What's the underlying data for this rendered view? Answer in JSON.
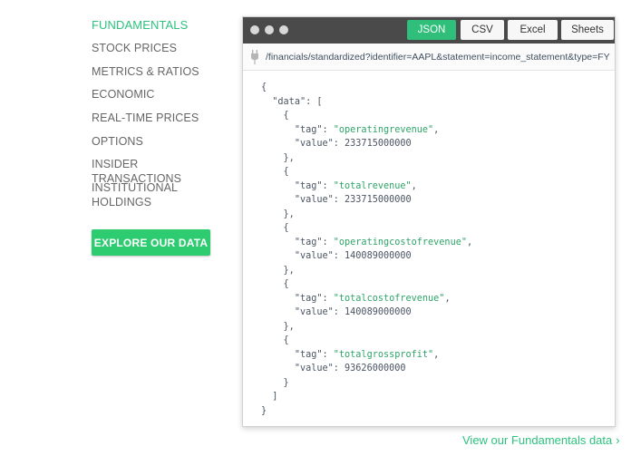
{
  "nav": {
    "items": [
      {
        "label": "FUNDAMENTALS",
        "active": true
      },
      {
        "label": "STOCK PRICES"
      },
      {
        "label": "METRICS & RATIOS"
      },
      {
        "label": "ECONOMIC"
      },
      {
        "label": "REAL-TIME PRICES"
      },
      {
        "label": "OPTIONS"
      },
      {
        "label": "INSIDER TRANSACTIONS"
      },
      {
        "label": "INSTITUTIONAL"
      },
      {
        "label": "HOLDINGS"
      }
    ],
    "explore_label": "EXPLORE OUR DATA"
  },
  "window": {
    "tabs": [
      "JSON",
      "CSV",
      "Excel",
      "Sheets"
    ],
    "active_tab": "JSON",
    "url": "/financials/standardized?identifier=AAPL&statement=income_statement&type=FY",
    "data": [
      {
        "tag": "operatingrevenue",
        "value": "233715000000"
      },
      {
        "tag": "totalrevenue",
        "value": "233715000000"
      },
      {
        "tag": "operatingcostofrevenue",
        "value": "140089000000"
      },
      {
        "tag": "totalcostofrevenue",
        "value": "140089000000"
      },
      {
        "tag": "totalgrossprofit",
        "value": "93626000000"
      }
    ]
  },
  "footer": {
    "link_label": "View our Fundamentals data",
    "chevron": "›"
  },
  "colors": {
    "accent": "#2ecc71",
    "titlebar": "#4a4a4a"
  },
  "icons": {
    "url": "plug-icon",
    "footer": "chevron-right-icon"
  }
}
